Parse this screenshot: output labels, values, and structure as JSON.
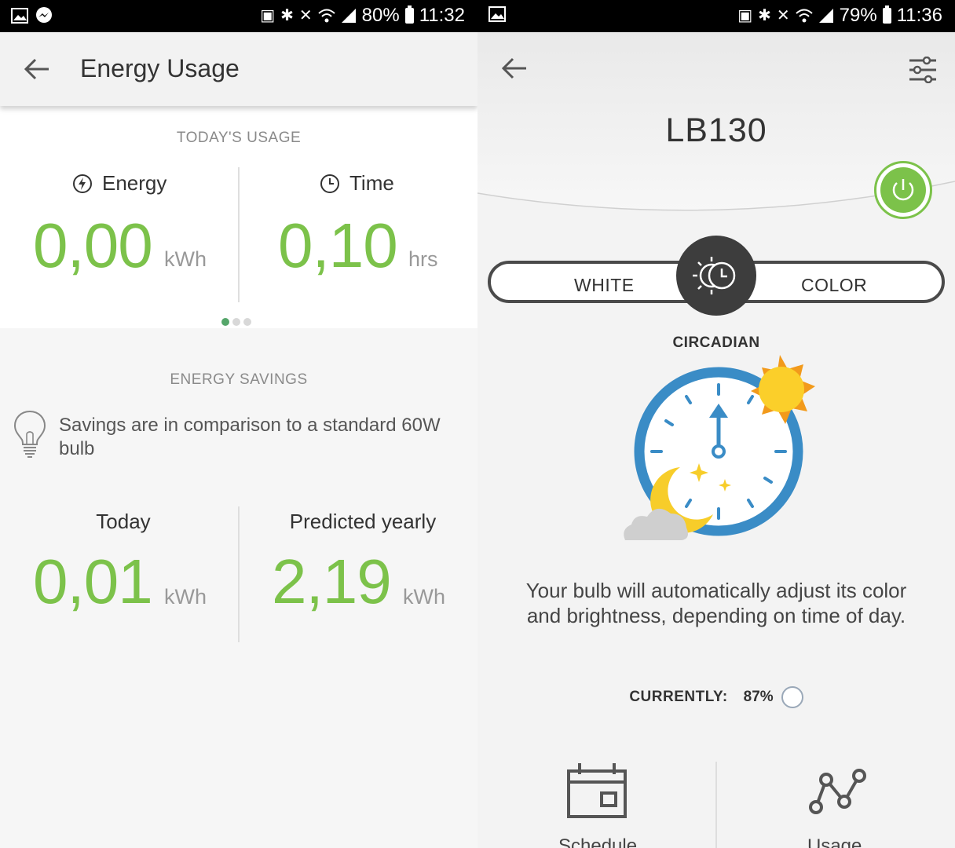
{
  "left": {
    "status": {
      "battery": "80%",
      "time": "11:32",
      "notif_icons": [
        "gallery-icon",
        "messenger-icon"
      ]
    },
    "appbar": {
      "title": "Energy Usage"
    },
    "today": {
      "section": "TODAY'S USAGE",
      "energy": {
        "label": "Energy",
        "value": "0,00",
        "unit": "kWh"
      },
      "time": {
        "label": "Time",
        "value": "0,10",
        "unit": "hrs"
      },
      "pager": {
        "pages": 3,
        "active": 1
      }
    },
    "savings": {
      "section": "ENERGY SAVINGS",
      "note": "Savings are in comparison to a standard 60W bulb",
      "today": {
        "label": "Today",
        "value": "0,01",
        "unit": "kWh"
      },
      "yearly": {
        "label": "Predicted yearly",
        "value": "2,19",
        "unit": "kWh"
      }
    }
  },
  "right": {
    "status": {
      "battery": "79%",
      "time": "11:36",
      "notif_icons": [
        "gallery-icon"
      ]
    },
    "device": {
      "name": "LB130",
      "power": "on"
    },
    "modes": {
      "white": "WHITE",
      "color": "COLOR",
      "selected": "CIRCADIAN"
    },
    "mode_title": "CIRCADIAN",
    "description": "Your bulb will automatically adjust its color and brightness, depending on time of day.",
    "currently": {
      "label": "CURRENTLY:",
      "value": "87%"
    },
    "bottom": {
      "schedule_label": "Schedule",
      "usage_label": "Usage"
    }
  },
  "colors": {
    "accent_green": "#7cc24a",
    "dark": "#3d3d3d",
    "pager_active": "#55a66a"
  }
}
